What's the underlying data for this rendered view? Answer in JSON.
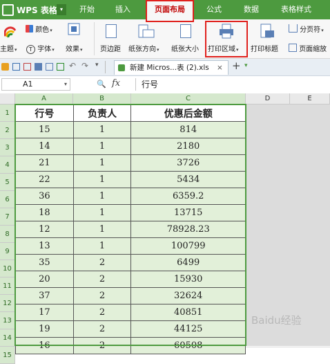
{
  "app": {
    "name": "WPS 表格"
  },
  "tabs": [
    "开始",
    "插入",
    "页面布局",
    "公式",
    "数据",
    "表格样式"
  ],
  "active_tab": "页面布局",
  "ribbon": {
    "theme_label": "主题",
    "color_label": "颜色",
    "font_label": "字体",
    "effect_label": "效果",
    "margins_label": "页边距",
    "orientation_label": "纸张方向",
    "size_label": "纸张大小",
    "print_area_label": "打印区域",
    "print_titles_label": "打印标题",
    "page_break_label": "分页符",
    "page_zoom_label": "页面缩放"
  },
  "document_tab": {
    "label": "新建 Micros...表 (2).xls",
    "close": "×",
    "add": "+"
  },
  "formula_bar": {
    "cell_ref": "A1",
    "fx": "fx",
    "content": "行号"
  },
  "columns": [
    "A",
    "B",
    "C",
    "D",
    "E"
  ],
  "rows": [
    "1",
    "2",
    "3",
    "4",
    "5",
    "6",
    "7",
    "8",
    "9",
    "10",
    "11",
    "12",
    "13",
    "14",
    "15"
  ],
  "table": {
    "headers": [
      "行号",
      "负责人",
      "优惠后金额"
    ],
    "rows": [
      [
        "15",
        "1",
        "814"
      ],
      [
        "14",
        "1",
        "2180"
      ],
      [
        "21",
        "1",
        "3726"
      ],
      [
        "22",
        "1",
        "5434"
      ],
      [
        "36",
        "1",
        "6359.2"
      ],
      [
        "18",
        "1",
        "13715"
      ],
      [
        "12",
        "1",
        "78928.23"
      ],
      [
        "13",
        "1",
        "100799"
      ],
      [
        "35",
        "2",
        "6499"
      ],
      [
        "20",
        "2",
        "15930"
      ],
      [
        "37",
        "2",
        "32624"
      ],
      [
        "17",
        "2",
        "40851"
      ],
      [
        "19",
        "2",
        "44125"
      ],
      [
        "16",
        "2",
        "60508"
      ]
    ]
  },
  "watermark": "Baidu经验",
  "colors": {
    "brand_green": "#4d9a3f",
    "highlight_red": "#e0201c",
    "cell_fill": "#e2f0d9"
  }
}
